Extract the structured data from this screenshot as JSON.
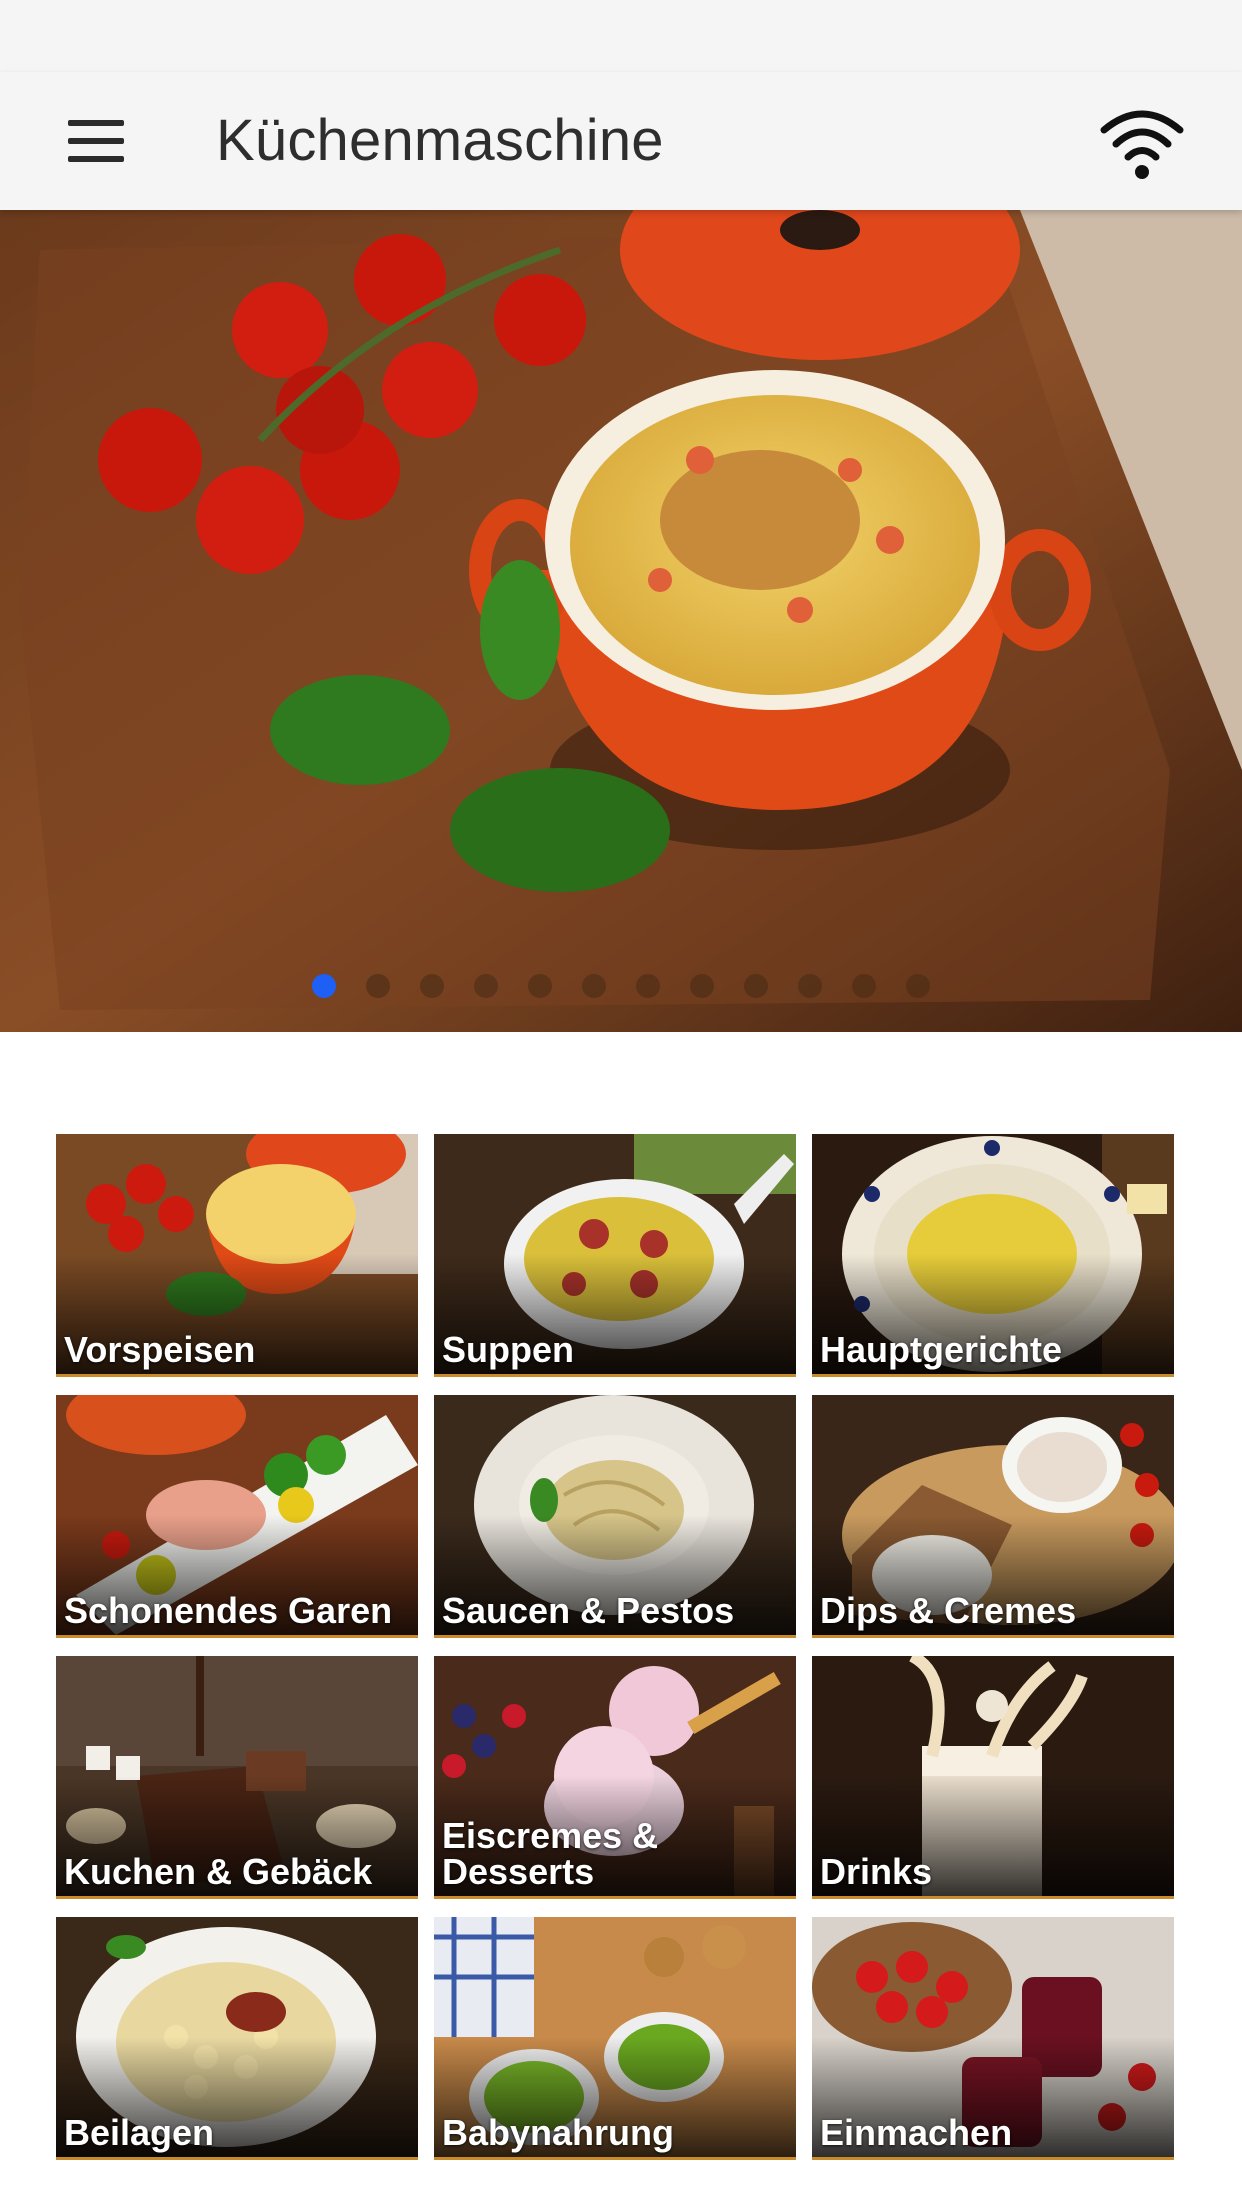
{
  "app_bar": {
    "title": "Küchenmaschine",
    "menu_icon": "hamburger-menu-icon",
    "connection_icon": "wifi-icon"
  },
  "hero": {
    "image": "soup-in-orange-cocotte-with-tomatoes-and-basil",
    "slide_count": 12,
    "active_slide": 1,
    "active_dot_color": "#1e5ff5"
  },
  "categories": [
    {
      "label": "Vorspeisen",
      "image": "cocotte-with-tomatoes"
    },
    {
      "label": "Suppen",
      "image": "soup-with-sausage-slices"
    },
    {
      "label": "Hauptgerichte",
      "image": "scrambled-eggs-plate"
    },
    {
      "label": "Schonendes Garen",
      "image": "salmon-with-vegetables"
    },
    {
      "label": "Saucen & Pestos",
      "image": "pasta-with-pesto"
    },
    {
      "label": "Dips & Cremes",
      "image": "bread-with-dip"
    },
    {
      "label": "Kuchen & Gebäck",
      "image": "chocolate-cake"
    },
    {
      "label": "Eiscremes & Desserts",
      "image": "berry-ice-cream"
    },
    {
      "label": "Drinks",
      "image": "milk-drink-splash"
    },
    {
      "label": "Beilagen",
      "image": "gnocchi-bowl"
    },
    {
      "label": "Babynahrung",
      "image": "green-puree-spoons"
    },
    {
      "label": "Einmachen",
      "image": "strawberries-and-jam"
    }
  ]
}
